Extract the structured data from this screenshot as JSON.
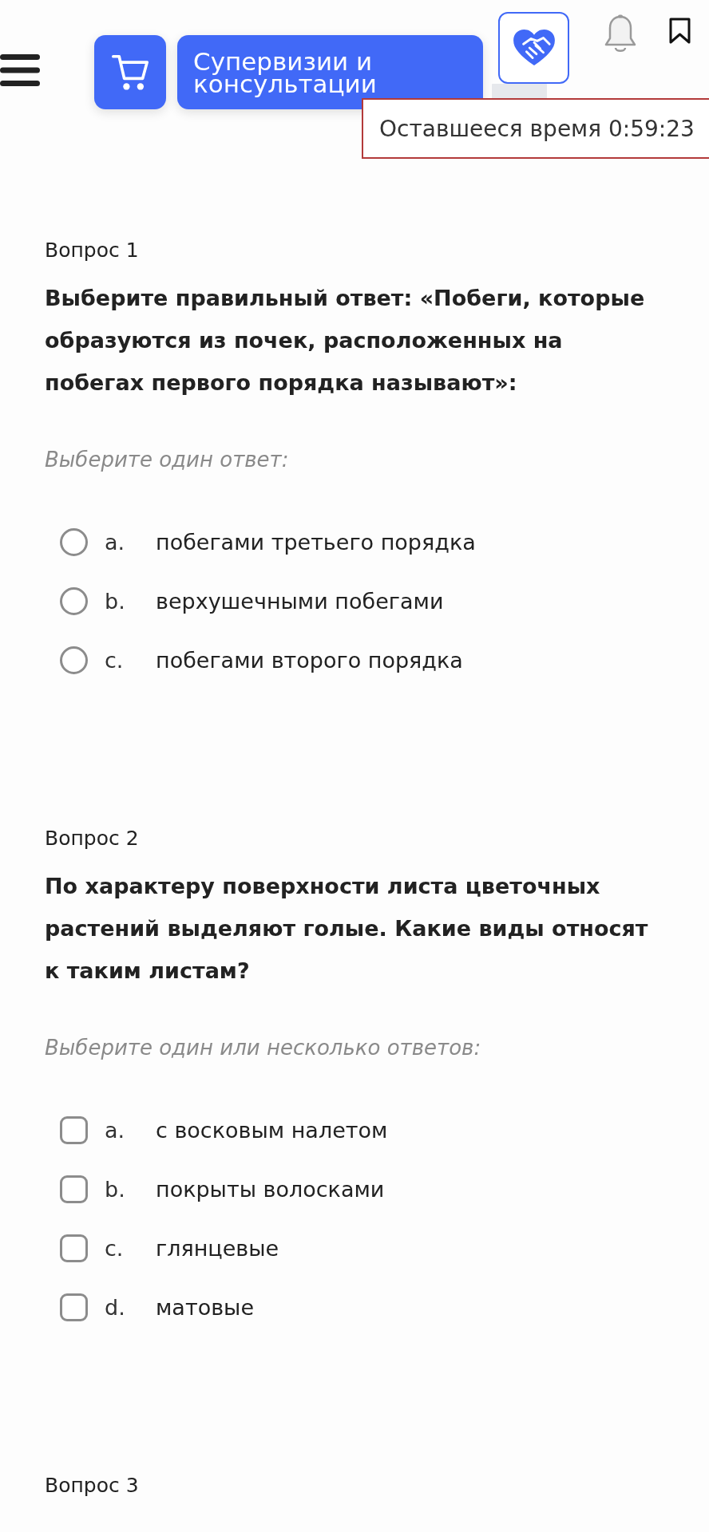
{
  "header": {
    "nav_button": "Супервизии и консультации",
    "timer": "Оставшееся время 0:59:23"
  },
  "questions": [
    {
      "number": "Вопрос 1",
      "text": "Выберите правильный ответ: «Побеги, которые образуются из почек, расположенных на побегах первого порядка называют»:",
      "instruction": "Выберите один ответ:",
      "kind": "single",
      "options": [
        {
          "letter": "a.",
          "text": "побегами третьего порядка",
          "checked": false
        },
        {
          "letter": "b.",
          "text": "верхушечными побегами",
          "checked": false
        },
        {
          "letter": "c.",
          "text": "побегами второго порядка",
          "checked": false
        }
      ]
    },
    {
      "number": "Вопрос 2",
      "text": "По характеру поверхности листа цветочных растений выделяют голые. Какие виды относят к таким листам?",
      "instruction": "Выберите один или несколько ответов:",
      "kind": "multiple",
      "options": [
        {
          "letter": "a.",
          "text": "с восковым налетом",
          "checked": false
        },
        {
          "letter": "b.",
          "text": "покрыты волосками",
          "checked": false
        },
        {
          "letter": "c.",
          "text": "глянцевые",
          "checked": false
        },
        {
          "letter": "d.",
          "text": "матовые",
          "checked": false
        }
      ]
    },
    {
      "number": "Вопрос 3"
    }
  ]
}
